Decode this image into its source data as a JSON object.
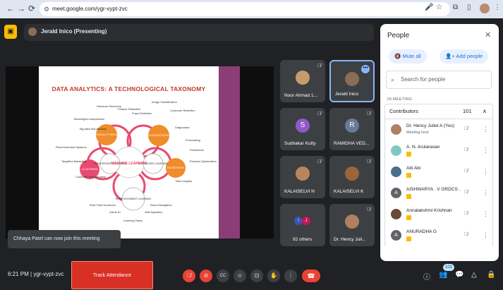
{
  "browser": {
    "url": "meet.google.com/ygr-vypt-zvc",
    "back_icon": "←",
    "forward_icon": "→",
    "reload_icon": "⟳",
    "mic_icon": "🎤",
    "star_icon": "☆",
    "ext_icon": "⧉",
    "sidebar_icon": "▯",
    "menu_icon": "⋮"
  },
  "meeting": {
    "presenter": "Jerald Inico (Presenting)",
    "code": "ygr-vypt-zvc",
    "time": "6:21 PM",
    "separator": "|",
    "toast": "Chhaya Patel can now join this meeting",
    "track_button": "Track Attendance"
  },
  "slide": {
    "title": "DATA ANALYTICS: A TECHNOLOGICAL TAXONOMY",
    "center": "MACHINE LEARNING",
    "nodes": [
      "DIMENSIONALITY REDUCTION",
      "CLASSIFICATION",
      "REGRESSION",
      "REINFORCEMENT LEARNING",
      "CLUSTERING"
    ],
    "sub_nodes": [
      "UNSUPERVISED LEARNING",
      "SUPERVISED LEARNING"
    ],
    "labels": [
      "Structure Discovery",
      "Feature Elicitation",
      "Image Classification",
      "Fraud Detection",
      "Customer Retention",
      "Meaningful compression",
      "Big data Visualisation",
      "Diagnostics",
      "Recommended Systems",
      "Forecasting",
      "Targetted Marketing",
      "Predictions",
      "Customer Segmentation",
      "Process Optimization",
      "New Insights",
      "Real-Time Decisions",
      "Robot Navigation",
      "Game AI",
      "Skill Aquisition",
      "Learning Tasks"
    ]
  },
  "tiles": [
    {
      "name": "Noor Ahmad 1...",
      "muted": "🎙̸"
    },
    {
      "name": "Jerald Inico",
      "more": "•••"
    },
    {
      "name": "Sudhakar Kutty",
      "letter": "S",
      "color": "#8e5ac9",
      "muted": "🎙̸"
    },
    {
      "name": "RAMIDHA VED...",
      "letter": "R",
      "color": "#6b7a99",
      "muted": "🎙̸"
    },
    {
      "name": "KALAISELVI N",
      "muted": "🎙̸"
    },
    {
      "name": "KALAISELVI K",
      "muted": "🎙̸"
    },
    {
      "name": "92 others"
    },
    {
      "name": "Dr. Hency Juli...",
      "muted": "🎙̸"
    }
  ],
  "people": {
    "title": "People",
    "close_icon": "✕",
    "mute_all": "Mute all",
    "add_people": "Add people",
    "search_placeholder": "Search for people",
    "search_icon": "⌕",
    "in_meeting": "IN MEETING",
    "contributors_label": "Contributors",
    "contributors_count": "101",
    "chev_icon": "∧",
    "list": [
      {
        "name": "Dr. Hency Juliet A (You)",
        "sub": "Meeting host",
        "color": "#b08060"
      },
      {
        "name": "A. N. Arularasan",
        "color": "#7fc8c0"
      },
      {
        "name": "Abi Abi",
        "color": "#4a6d8c"
      },
      {
        "name": "AISHWARYA . V GRDCS ...",
        "color": "#5f6368",
        "letter": "A"
      },
      {
        "name": "Annalakshmi Krishnan",
        "color": "#6b4a3a"
      },
      {
        "name": "ANURADHA G",
        "color": "#5f6368",
        "letter": "A"
      }
    ]
  },
  "controls": {
    "mic": "🎙̸",
    "cam": "⊘",
    "cc": "CC",
    "emoji": "☺",
    "present": "⊡",
    "hand": "✋",
    "more": "⋮",
    "hang": "☎",
    "info": "ⓘ",
    "people": "👥",
    "people_badge": "101",
    "chat": "💬",
    "activities": "△",
    "lock": "🔒"
  }
}
